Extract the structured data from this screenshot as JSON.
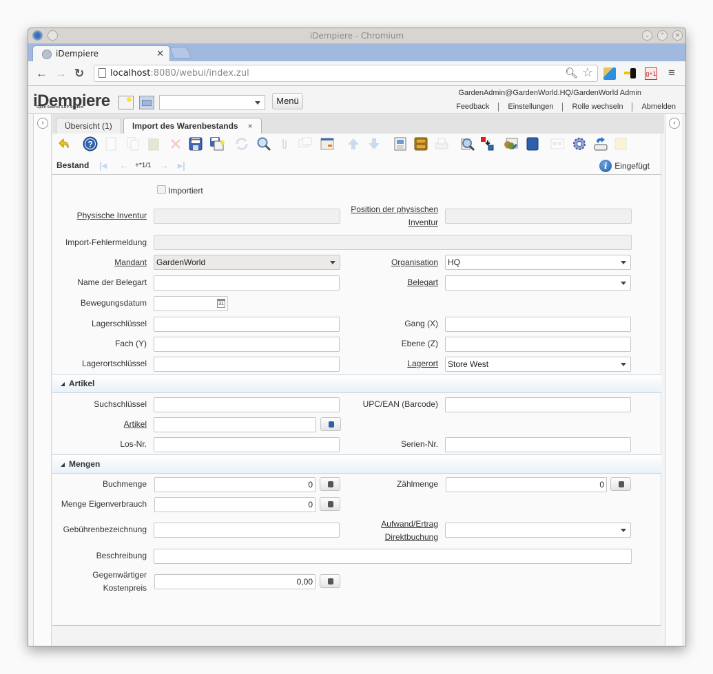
{
  "browser": {
    "window_title": "iDempiere - Chromium",
    "tab_title": "iDempiere",
    "url_host": "localhost",
    "url_rest": ":8080/webui/index.zul"
  },
  "header": {
    "logo": "iDempiere",
    "logo_sub": "Open Source ERP System",
    "search_value": "",
    "menu_label": "Menü",
    "user_info": "GardenAdmin@GardenWorld.HQ/GardenWorld Admin",
    "links": [
      "Feedback",
      "Einstellungen",
      "Rolle wechseln",
      "Abmelden"
    ]
  },
  "tabs": [
    {
      "label": "Übersicht (1)",
      "active": false
    },
    {
      "label": "Import des Warenbestands",
      "active": true,
      "close": "×"
    }
  ],
  "toolbar": {
    "buttons": [
      {
        "name": "undo",
        "enabled": true
      },
      {
        "name": "help",
        "enabled": true
      },
      {
        "name": "new",
        "enabled": false
      },
      {
        "name": "copy",
        "enabled": false
      },
      {
        "name": "delete",
        "enabled": false
      },
      {
        "name": "delete-selection",
        "enabled": false
      },
      {
        "name": "save",
        "enabled": true
      },
      {
        "name": "save-and-new",
        "enabled": true
      },
      {
        "name": "refresh",
        "enabled": false
      },
      {
        "name": "find",
        "enabled": true
      },
      {
        "name": "attachment",
        "enabled": false
      },
      {
        "name": "chat",
        "enabled": false
      },
      {
        "name": "grid-toggle",
        "enabled": true
      },
      {
        "name": "parent-record",
        "enabled": false
      },
      {
        "name": "detail-record",
        "enabled": false
      },
      {
        "name": "report",
        "enabled": true
      },
      {
        "name": "archive",
        "enabled": true
      },
      {
        "name": "print",
        "enabled": false
      },
      {
        "name": "zoom-across",
        "enabled": true
      },
      {
        "name": "active-workflows",
        "enabled": true
      },
      {
        "name": "requests",
        "enabled": true
      },
      {
        "name": "product-info",
        "enabled": true
      },
      {
        "name": "quick-form",
        "enabled": false
      },
      {
        "name": "process",
        "enabled": true
      },
      {
        "name": "export",
        "enabled": true
      },
      {
        "name": "post-it",
        "enabled": false
      }
    ]
  },
  "record_nav": {
    "tab_name": "Bestand",
    "counter": "+*1/1",
    "status": "Eingefügt"
  },
  "form": {
    "importiert": {
      "label": "Importiert",
      "checked": false
    },
    "physische_inventur": {
      "label": "Physische Inventur",
      "value": ""
    },
    "position_inventur": {
      "label_1": "Position der physischen",
      "label_2": "Inventur",
      "value": ""
    },
    "fehlermeldung": {
      "label": "Import-Fehlermeldung",
      "value": ""
    },
    "mandant": {
      "label": "Mandant",
      "value": "GardenWorld"
    },
    "organisation": {
      "label": "Organisation",
      "value": "HQ"
    },
    "name_belegart": {
      "label": "Name der Belegart",
      "value": ""
    },
    "belegart": {
      "label": "Belegart",
      "value": ""
    },
    "bewegungsdatum": {
      "label": "Bewegungsdatum",
      "value": "",
      "cal_day": "31"
    },
    "lagerschluessel": {
      "label": "Lagerschlüssel",
      "value": ""
    },
    "gang": {
      "label": "Gang (X)",
      "value": ""
    },
    "fach": {
      "label": "Fach (Y)",
      "value": ""
    },
    "ebene": {
      "label": "Ebene (Z)",
      "value": ""
    },
    "lagerortschluessel": {
      "label": "Lagerortschlüssel",
      "value": ""
    },
    "lagerort": {
      "label": "Lagerort",
      "value": "Store West"
    }
  },
  "section_artikel": {
    "title": "Artikel",
    "suchschluessel": {
      "label": "Suchschlüssel",
      "value": ""
    },
    "upc": {
      "label": "UPC/EAN (Barcode)",
      "value": ""
    },
    "artikel": {
      "label": "Artikel",
      "value": ""
    },
    "los_nr": {
      "label": "Los-Nr.",
      "value": ""
    },
    "serien_nr": {
      "label": "Serien-Nr.",
      "value": ""
    }
  },
  "section_mengen": {
    "title": "Mengen",
    "buchmenge": {
      "label": "Buchmenge",
      "value": "0"
    },
    "zaehlmenge": {
      "label": "Zählmenge",
      "value": "0"
    },
    "eigenverbrauch": {
      "label": "Menge Eigenverbrauch",
      "value": "0"
    },
    "gebuehren": {
      "label": "Gebührenbezeichnung",
      "value": ""
    },
    "aufwand": {
      "label_1": "Aufwand/Ertrag",
      "label_2": "Direktbuchung",
      "value": ""
    },
    "beschreibung": {
      "label": "Beschreibung",
      "value": ""
    },
    "kostenpreis": {
      "label_1": "Gegenwärtiger",
      "label_2": "Kostenpreis",
      "value": "0,00"
    }
  }
}
